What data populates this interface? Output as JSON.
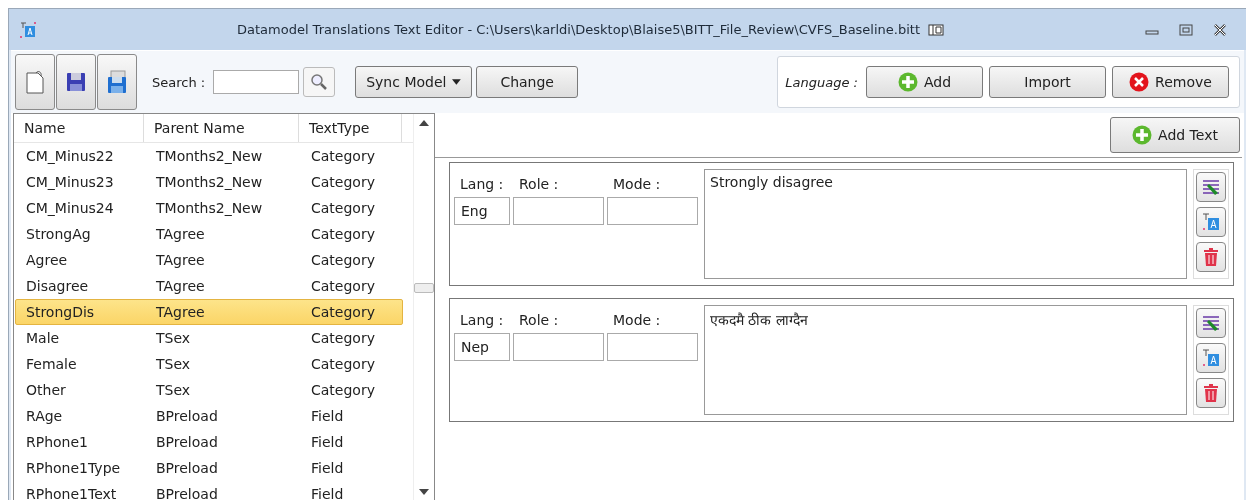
{
  "window": {
    "title": "Datamodel Translations Text Editor - C:\\Users\\karldi\\Desktop\\Blaise5\\BITT_File_Review\\CVFS_Baseline.bitt"
  },
  "toolbar": {
    "search_label": "Search :",
    "sync_button": "Sync Model",
    "change_button": "Change",
    "language_label": "Language :",
    "language_buttons": [
      {
        "kind": "add",
        "label": "Add"
      },
      {
        "kind": "plain",
        "label": "Import"
      },
      {
        "kind": "remove",
        "label": "Remove"
      }
    ]
  },
  "table": {
    "columns": [
      "Name",
      "Parent Name",
      "TextType"
    ],
    "rows": [
      {
        "cells": [
          "CM_Minus22",
          "TMonths2_New",
          "Category"
        ],
        "selected": false
      },
      {
        "cells": [
          "CM_Minus23",
          "TMonths2_New",
          "Category"
        ],
        "selected": false
      },
      {
        "cells": [
          "CM_Minus24",
          "TMonths2_New",
          "Category"
        ],
        "selected": false
      },
      {
        "cells": [
          "StrongAg",
          "TAgree",
          "Category"
        ],
        "selected": false
      },
      {
        "cells": [
          "Agree",
          "TAgree",
          "Category"
        ],
        "selected": false
      },
      {
        "cells": [
          "Disagree",
          "TAgree",
          "Category"
        ],
        "selected": false
      },
      {
        "cells": [
          "StrongDis",
          "TAgree",
          "Category"
        ],
        "selected": true
      },
      {
        "cells": [
          "Male",
          "TSex",
          "Category"
        ],
        "selected": false
      },
      {
        "cells": [
          "Female",
          "TSex",
          "Category"
        ],
        "selected": false
      },
      {
        "cells": [
          "Other",
          "TSex",
          "Category"
        ],
        "selected": false
      },
      {
        "cells": [
          "RAge",
          "BPreload",
          "Field"
        ],
        "selected": false
      },
      {
        "cells": [
          "RPhone1",
          "BPreload",
          "Field"
        ],
        "selected": false
      },
      {
        "cells": [
          "RPhone1Type",
          "BPreload",
          "Field"
        ],
        "selected": false
      },
      {
        "cells": [
          "RPhone1Text",
          "BPreload",
          "Field"
        ],
        "selected": false
      }
    ]
  },
  "add_text_button": "Add Text",
  "entries": [
    {
      "lang_label": "Lang :",
      "role_label": "Role :",
      "mode_label": "Mode :",
      "lang": "Eng",
      "text": "Strongly disagree"
    },
    {
      "lang_label": "Lang :",
      "role_label": "Role :",
      "mode_label": "Mode :",
      "lang": "Nep",
      "text": "एकदमै ठीक लाग्दैन"
    }
  ]
}
